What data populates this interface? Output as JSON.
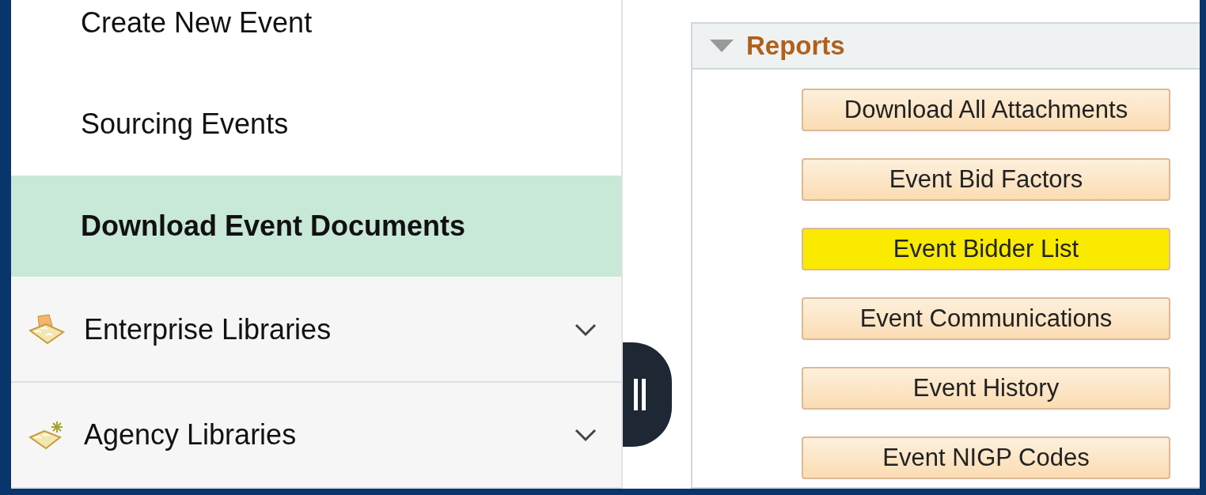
{
  "sidebar": {
    "items": [
      {
        "label": "Create New Event",
        "selected": false,
        "kind": "link"
      },
      {
        "label": "Sourcing Events",
        "selected": false,
        "kind": "link"
      },
      {
        "label": "Download Event Documents",
        "selected": true,
        "kind": "link"
      },
      {
        "label": "Enterprise Libraries",
        "selected": false,
        "kind": "folder",
        "expanded": false
      },
      {
        "label": "Agency Libraries",
        "selected": false,
        "kind": "folder_new",
        "expanded": false
      }
    ]
  },
  "reports": {
    "title": "Reports",
    "expanded": true,
    "buttons": [
      {
        "label": "Download All Attachments",
        "highlighted": false
      },
      {
        "label": "Event Bid Factors",
        "highlighted": false
      },
      {
        "label": "Event Bidder List",
        "highlighted": true
      },
      {
        "label": "Event Communications",
        "highlighted": false
      },
      {
        "label": "Event History",
        "highlighted": false
      },
      {
        "label": "Event NIGP Codes",
        "highlighted": false
      }
    ]
  }
}
